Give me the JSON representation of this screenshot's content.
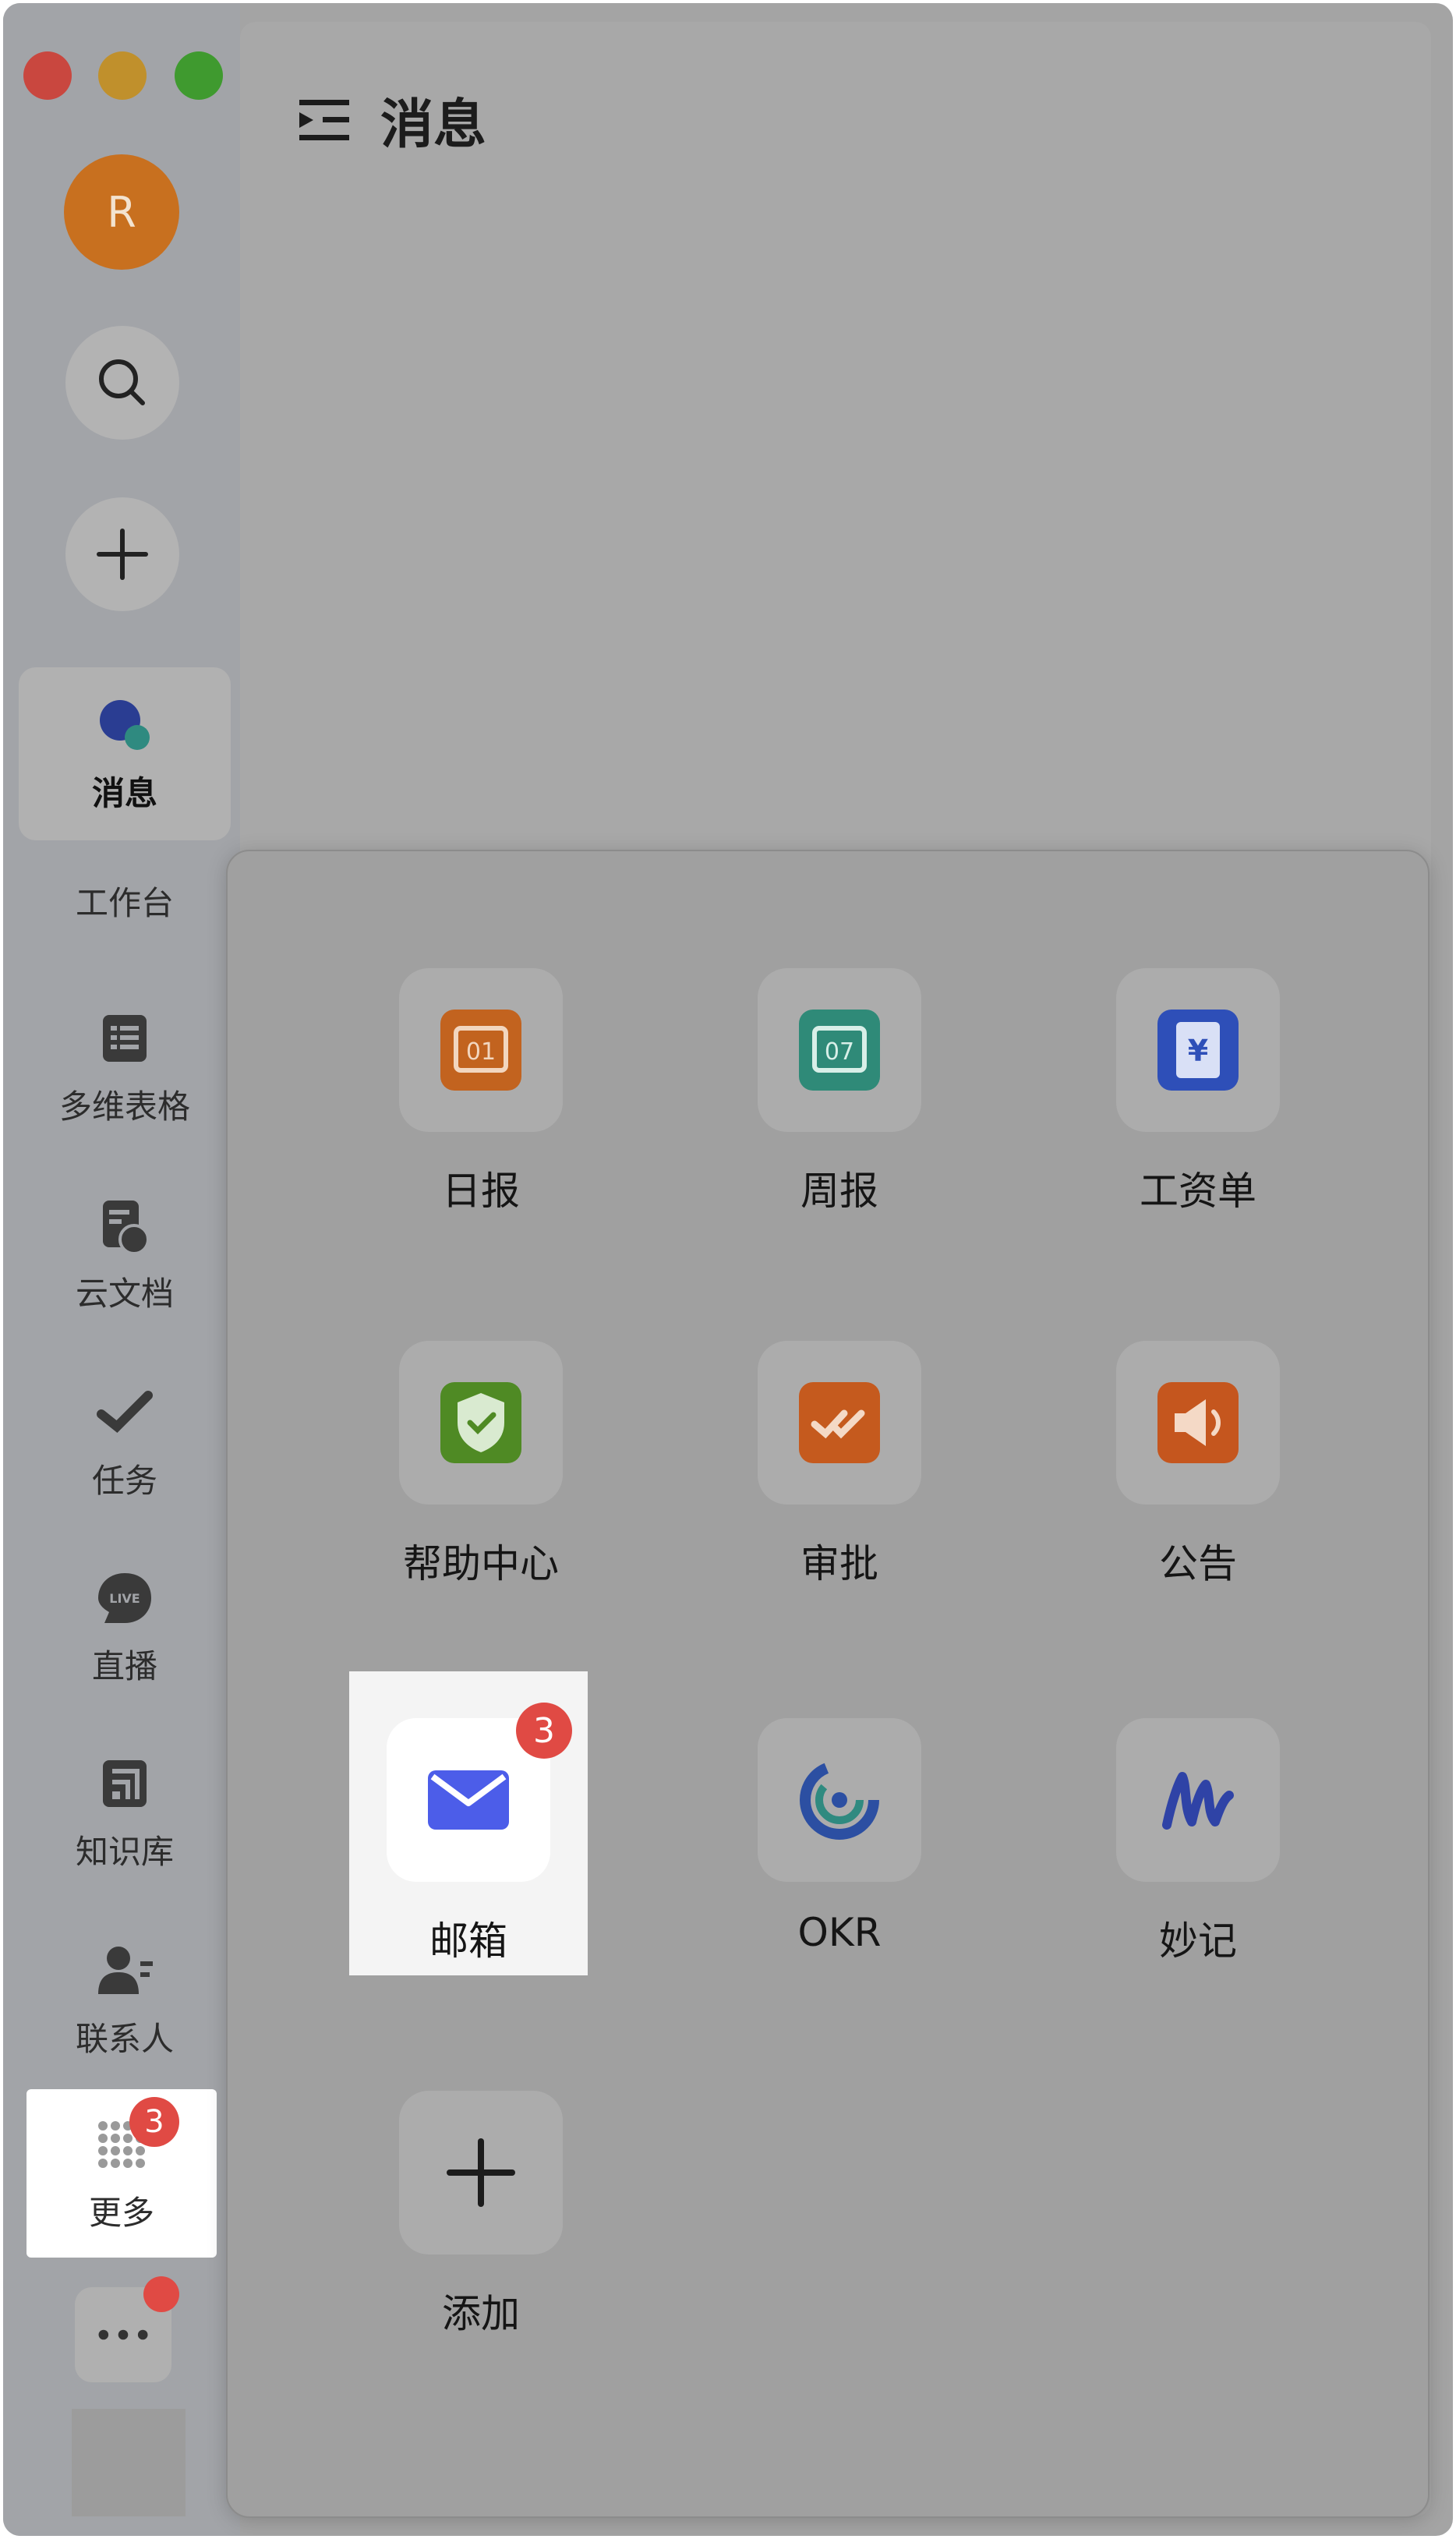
{
  "window": {
    "traffic_lights": {
      "close": "#c9473f",
      "minimize": "#c0902c",
      "zoom": "#3f9a2f"
    }
  },
  "sidebar": {
    "avatar_initial": "R",
    "items": [
      {
        "key": "messages",
        "label": "消息",
        "icon": "chat-bubble-icon",
        "active": true
      },
      {
        "key": "workbench",
        "label": "工作台",
        "icon": "workbench-icon"
      },
      {
        "key": "multi-table",
        "label": "多维表格",
        "icon": "table-icon"
      },
      {
        "key": "docs",
        "label": "云文档",
        "icon": "document-icon"
      },
      {
        "key": "tasks",
        "label": "任务",
        "icon": "task-check-icon"
      },
      {
        "key": "live",
        "label": "直播",
        "icon": "live-icon"
      },
      {
        "key": "wiki",
        "label": "知识库",
        "icon": "wiki-icon"
      },
      {
        "key": "contacts",
        "label": "联系人",
        "icon": "contacts-icon"
      },
      {
        "key": "more",
        "label": "更多",
        "icon": "grid-dots-icon",
        "badge": "3"
      }
    ]
  },
  "main": {
    "title": "消息"
  },
  "more_panel": {
    "apps": [
      {
        "key": "daily",
        "label": "日报",
        "icon": "calendar-01-icon",
        "color": "#c2631f",
        "text": "01"
      },
      {
        "key": "weekly",
        "label": "周报",
        "icon": "calendar-07-icon",
        "color": "#2f8a78",
        "text": "07"
      },
      {
        "key": "payslip",
        "label": "工资单",
        "icon": "payslip-icon",
        "color": "#2e4fb8",
        "text": "¥"
      },
      {
        "key": "help",
        "label": "帮助中心",
        "icon": "help-center-icon",
        "color": "#4f8a24"
      },
      {
        "key": "approval",
        "label": "审批",
        "icon": "approval-icon",
        "color": "#c55a1e"
      },
      {
        "key": "announcement",
        "label": "公告",
        "icon": "megaphone-icon",
        "color": "#c5561e"
      },
      {
        "key": "mail",
        "label": "邮箱",
        "icon": "mail-icon",
        "color": "#4c5de9",
        "badge": "3"
      },
      {
        "key": "okr",
        "label": "OKR",
        "icon": "okr-icon",
        "color": "#2c4fa2"
      },
      {
        "key": "minutes",
        "label": "妙记",
        "icon": "minutes-icon",
        "color": "#2f43a6"
      },
      {
        "key": "add",
        "label": "添加",
        "icon": "plus-icon"
      }
    ]
  }
}
